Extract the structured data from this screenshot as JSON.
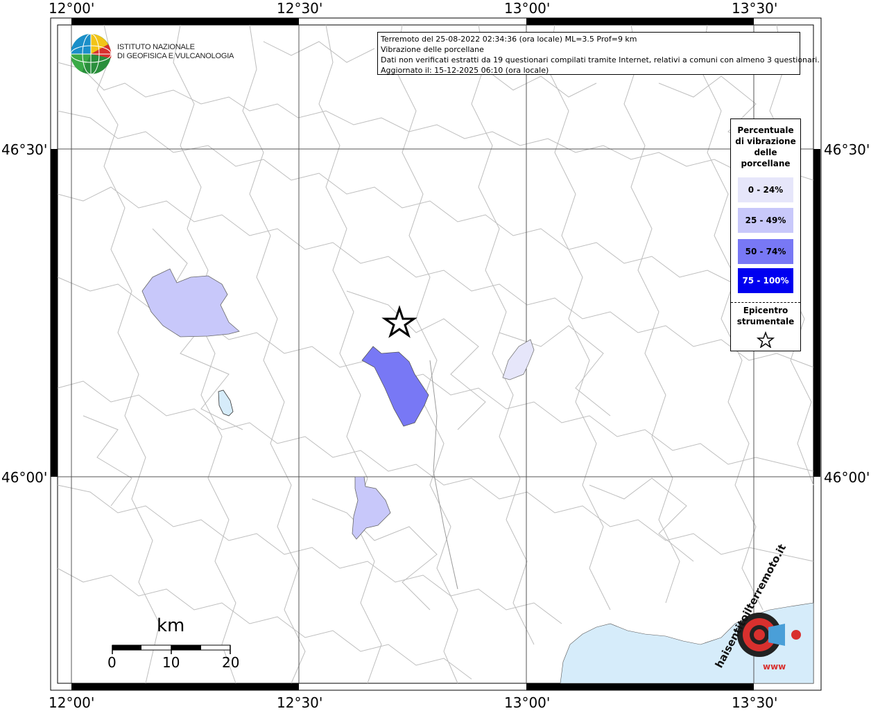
{
  "map": {
    "lon_labels_top": [
      "12°00'",
      "12°30'",
      "13°00'",
      "13°30'"
    ],
    "lon_labels_bottom": [
      "12°00'",
      "12°30'",
      "13°00'",
      "13°30'"
    ],
    "lat_labels_left": [
      "46°30'",
      "46°00'"
    ],
    "lat_labels_right": [
      "46°30'",
      "46°00'"
    ]
  },
  "info": {
    "line1": "Terremoto del 25-08-2022 02:34:36 (ora locale) ML=3.5 Prof=9 km",
    "line2": "Vibrazione delle porcellane",
    "line3": "Dati non verificati estratti da 19 questionari compilati tramite Internet, relativi a comuni con almeno 3 questionari.",
    "line4": "Aggiornato il: 15-12-2025 06:10 (ora locale)"
  },
  "logo": {
    "line1": "ISTITUTO NAZIONALE",
    "line2": "DI GEOFISICA E VULCANOLOGIA"
  },
  "legend": {
    "title": "Percentuale di vibrazione delle porcellane",
    "items": [
      {
        "label": "0 - 24%",
        "color": "#e6e6fa"
      },
      {
        "label": "25 - 49%",
        "color": "#c8c8fa"
      },
      {
        "label": "50 - 74%",
        "color": "#7878f5"
      },
      {
        "label": "75 - 100%",
        "color": "#0000f0"
      }
    ],
    "epicenter_label": "Epicentro strumentale"
  },
  "scale": {
    "unit": "km",
    "ticks": [
      "0",
      "10",
      "20"
    ]
  },
  "watermark": {
    "text": "haisentitoilterremoto.it",
    "url": "www"
  },
  "colors": {
    "sea": "#d6ecfa",
    "boundaries": "#b4b4b4",
    "frame": "#000000"
  }
}
